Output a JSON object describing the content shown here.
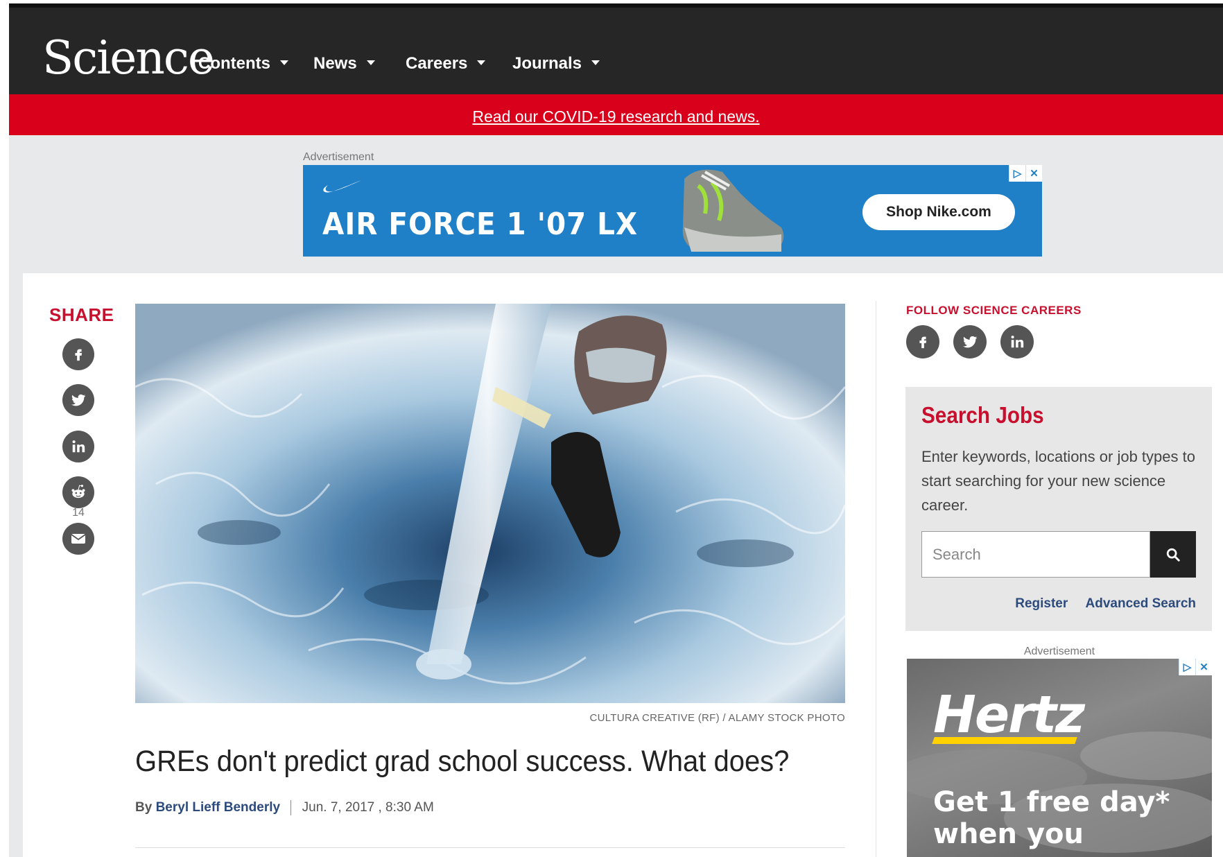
{
  "header": {
    "logo": "Science",
    "nav": [
      {
        "label": "Contents"
      },
      {
        "label": "News"
      },
      {
        "label": "Careers"
      },
      {
        "label": "Journals"
      }
    ]
  },
  "banner": {
    "link_text": "Read our COVID-19 research and news."
  },
  "top_ad": {
    "label": "Advertisement",
    "headline": "AIR FORCE 1 '07 LX",
    "cta": "Shop Nike.com",
    "choices_icon": "▷",
    "close_icon": "✕"
  },
  "share": {
    "title": "SHARE",
    "icons": [
      "facebook-icon",
      "twitter-icon",
      "linkedin-icon",
      "reddit-icon",
      "email-icon"
    ],
    "reddit_count": "14"
  },
  "article": {
    "image_credit": "CULTURA CREATIVE (RF) / ALAMY STOCK PHOTO",
    "headline": "GREs don't predict grad school success. What does?",
    "by": "By",
    "author": "Beryl Lieff Benderly",
    "date": "Jun. 7, 2017 , 8:30 AM"
  },
  "sidebar": {
    "follow_title": "FOLLOW SCIENCE CAREERS",
    "follow_icons": [
      "facebook-icon",
      "twitter-icon",
      "linkedin-icon"
    ],
    "jobs": {
      "title": "Search Jobs",
      "description": "Enter keywords, locations or job types to start searching for your new science career.",
      "search_placeholder": "Search",
      "register": "Register",
      "advanced": "Advanced Search"
    },
    "ad": {
      "label": "Advertisement",
      "brand": "Hertz",
      "copy_line1": "Get 1 free day*",
      "copy_line2": "when you"
    }
  },
  "colors": {
    "accent_red": "#c8102e",
    "nav_bg": "#262626",
    "banner_red": "#d9001b",
    "link_blue": "#2c4a7c",
    "nike_blue": "#1f7fc7",
    "hertz_yellow": "#ffd100"
  }
}
